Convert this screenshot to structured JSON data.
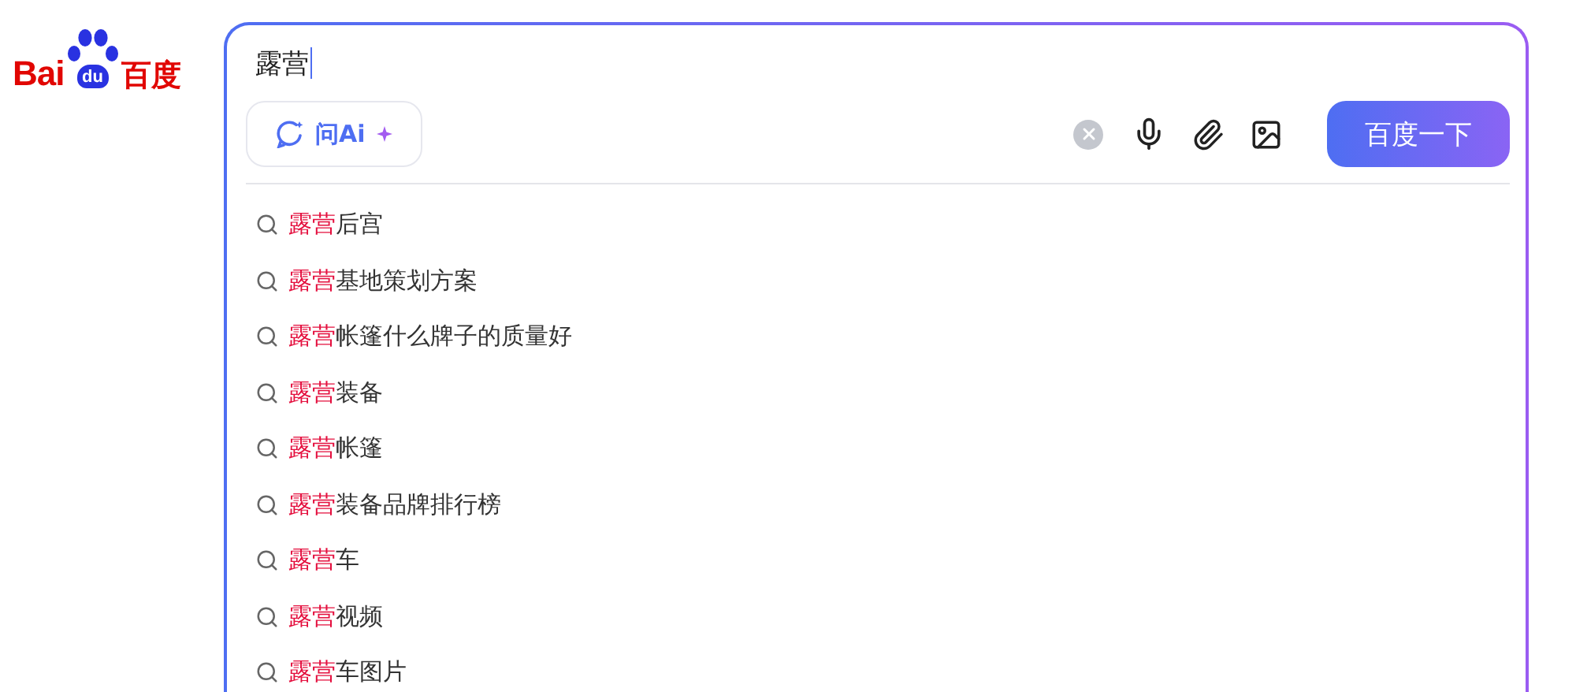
{
  "logo": {
    "left": "Bai",
    "paw": "du",
    "right": "百度"
  },
  "search": {
    "value": "露营",
    "ai_button": "问Ai",
    "submit": "百度一下"
  },
  "suggestions": [
    {
      "highlight": "露营",
      "rest": "后宫"
    },
    {
      "highlight": "露营",
      "rest": "基地策划方案"
    },
    {
      "highlight": "露营",
      "rest": "帐篷什么牌子的质量好"
    },
    {
      "highlight": "露营",
      "rest": "装备"
    },
    {
      "highlight": "露营",
      "rest": "帐篷"
    },
    {
      "highlight": "露营",
      "rest": "装备品牌排行榜"
    },
    {
      "highlight": "露营",
      "rest": "车"
    },
    {
      "highlight": "露营",
      "rest": "视频"
    },
    {
      "highlight": "露营",
      "rest": "车图片"
    }
  ]
}
